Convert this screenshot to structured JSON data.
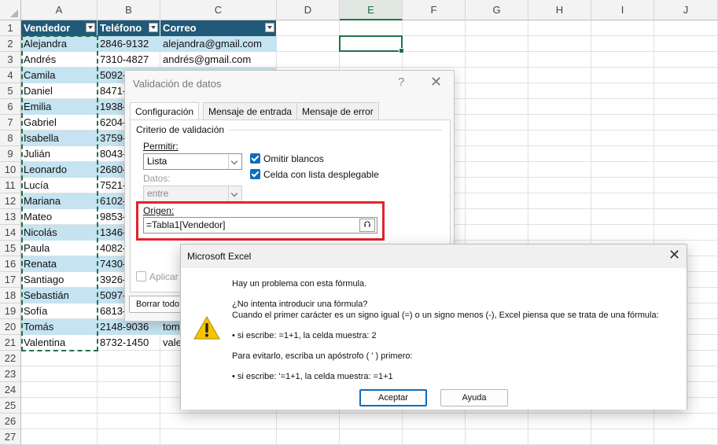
{
  "sheet": {
    "columns": [
      "A",
      "B",
      "C",
      "D",
      "E",
      "F",
      "G",
      "H",
      "I",
      "J"
    ],
    "selected_column": "E",
    "rows": [
      "1",
      "2",
      "3",
      "4",
      "5",
      "6",
      "7",
      "8",
      "9",
      "10",
      "11",
      "12",
      "13",
      "14",
      "15",
      "16",
      "17",
      "18",
      "19",
      "20",
      "21",
      "22",
      "23",
      "24",
      "25",
      "26",
      "27"
    ],
    "table_headers": [
      "Vendedor",
      "Teléfono",
      "Correo"
    ],
    "table_rows": [
      [
        "Alejandra",
        "2846-9132",
        "alejandra@gmail.com"
      ],
      [
        "Andrés",
        "7310-4827",
        "andrés@gmail.com"
      ],
      [
        "Camila",
        "5092-",
        ""
      ],
      [
        "Daniel",
        "8471-",
        ""
      ],
      [
        "Emilia",
        "1938-",
        ""
      ],
      [
        "Gabriel",
        "6204-",
        ""
      ],
      [
        "Isabella",
        "3759-",
        ""
      ],
      [
        "Julián",
        "8043-",
        ""
      ],
      [
        "Leonardo",
        "2680-",
        ""
      ],
      [
        "Lucía",
        "7521-",
        ""
      ],
      [
        "Mariana",
        "6102-",
        ""
      ],
      [
        "Mateo",
        "9853-",
        ""
      ],
      [
        "Nicolás",
        "1346-",
        ""
      ],
      [
        "Paula",
        "4082-",
        ""
      ],
      [
        "Renata",
        "7430-",
        ""
      ],
      [
        "Santiago",
        "3926-",
        ""
      ],
      [
        "Sebastián",
        "5097-",
        ""
      ],
      [
        "Sofía",
        "6813-",
        ""
      ],
      [
        "Tomás",
        "2148-9036",
        "tom"
      ],
      [
        "Valentina",
        "8732-1450",
        "vale"
      ]
    ]
  },
  "validation_dialog": {
    "title": "Validación de datos",
    "help": "?",
    "close": "✕",
    "tabs": [
      "Configuración",
      "Mensaje de entrada",
      "Mensaje de error"
    ],
    "group_label": "Criterio de validación",
    "allow_label": "Permitir:",
    "allow_value": "Lista",
    "data_label": "Datos:",
    "data_value": "entre",
    "ignore_blank": "Omitir blancos",
    "in_cell_dropdown": "Celda con lista desplegable",
    "source_label": "Origen:",
    "source_value": "=Tabla1[Vendedor]",
    "apply_label": "Aplicar",
    "clear_all": "Borrar todo"
  },
  "message_box": {
    "title": "Microsoft Excel",
    "close": "✕",
    "lines": [
      "Hay un problema con esta fórmula.",
      "¿No intenta introducir una fórmula?",
      "Cuando el primer carácter es un signo igual (=) o un signo menos (-), Excel piensa que se trata de una fórmula:",
      "• si escribe:   =1+1, la celda muestra:   2",
      "Para evitarlo, escriba un apóstrofo ( ' ) primero:",
      "• si escribe:   '=1+1, la celda muestra:   =1+1"
    ],
    "ok_label": "Aceptar",
    "help_label": "Ayuda"
  },
  "colors": {
    "accent": "#217346",
    "table_header": "#215a78",
    "band": "#c5e3f1",
    "highlight": "#e0242c"
  }
}
